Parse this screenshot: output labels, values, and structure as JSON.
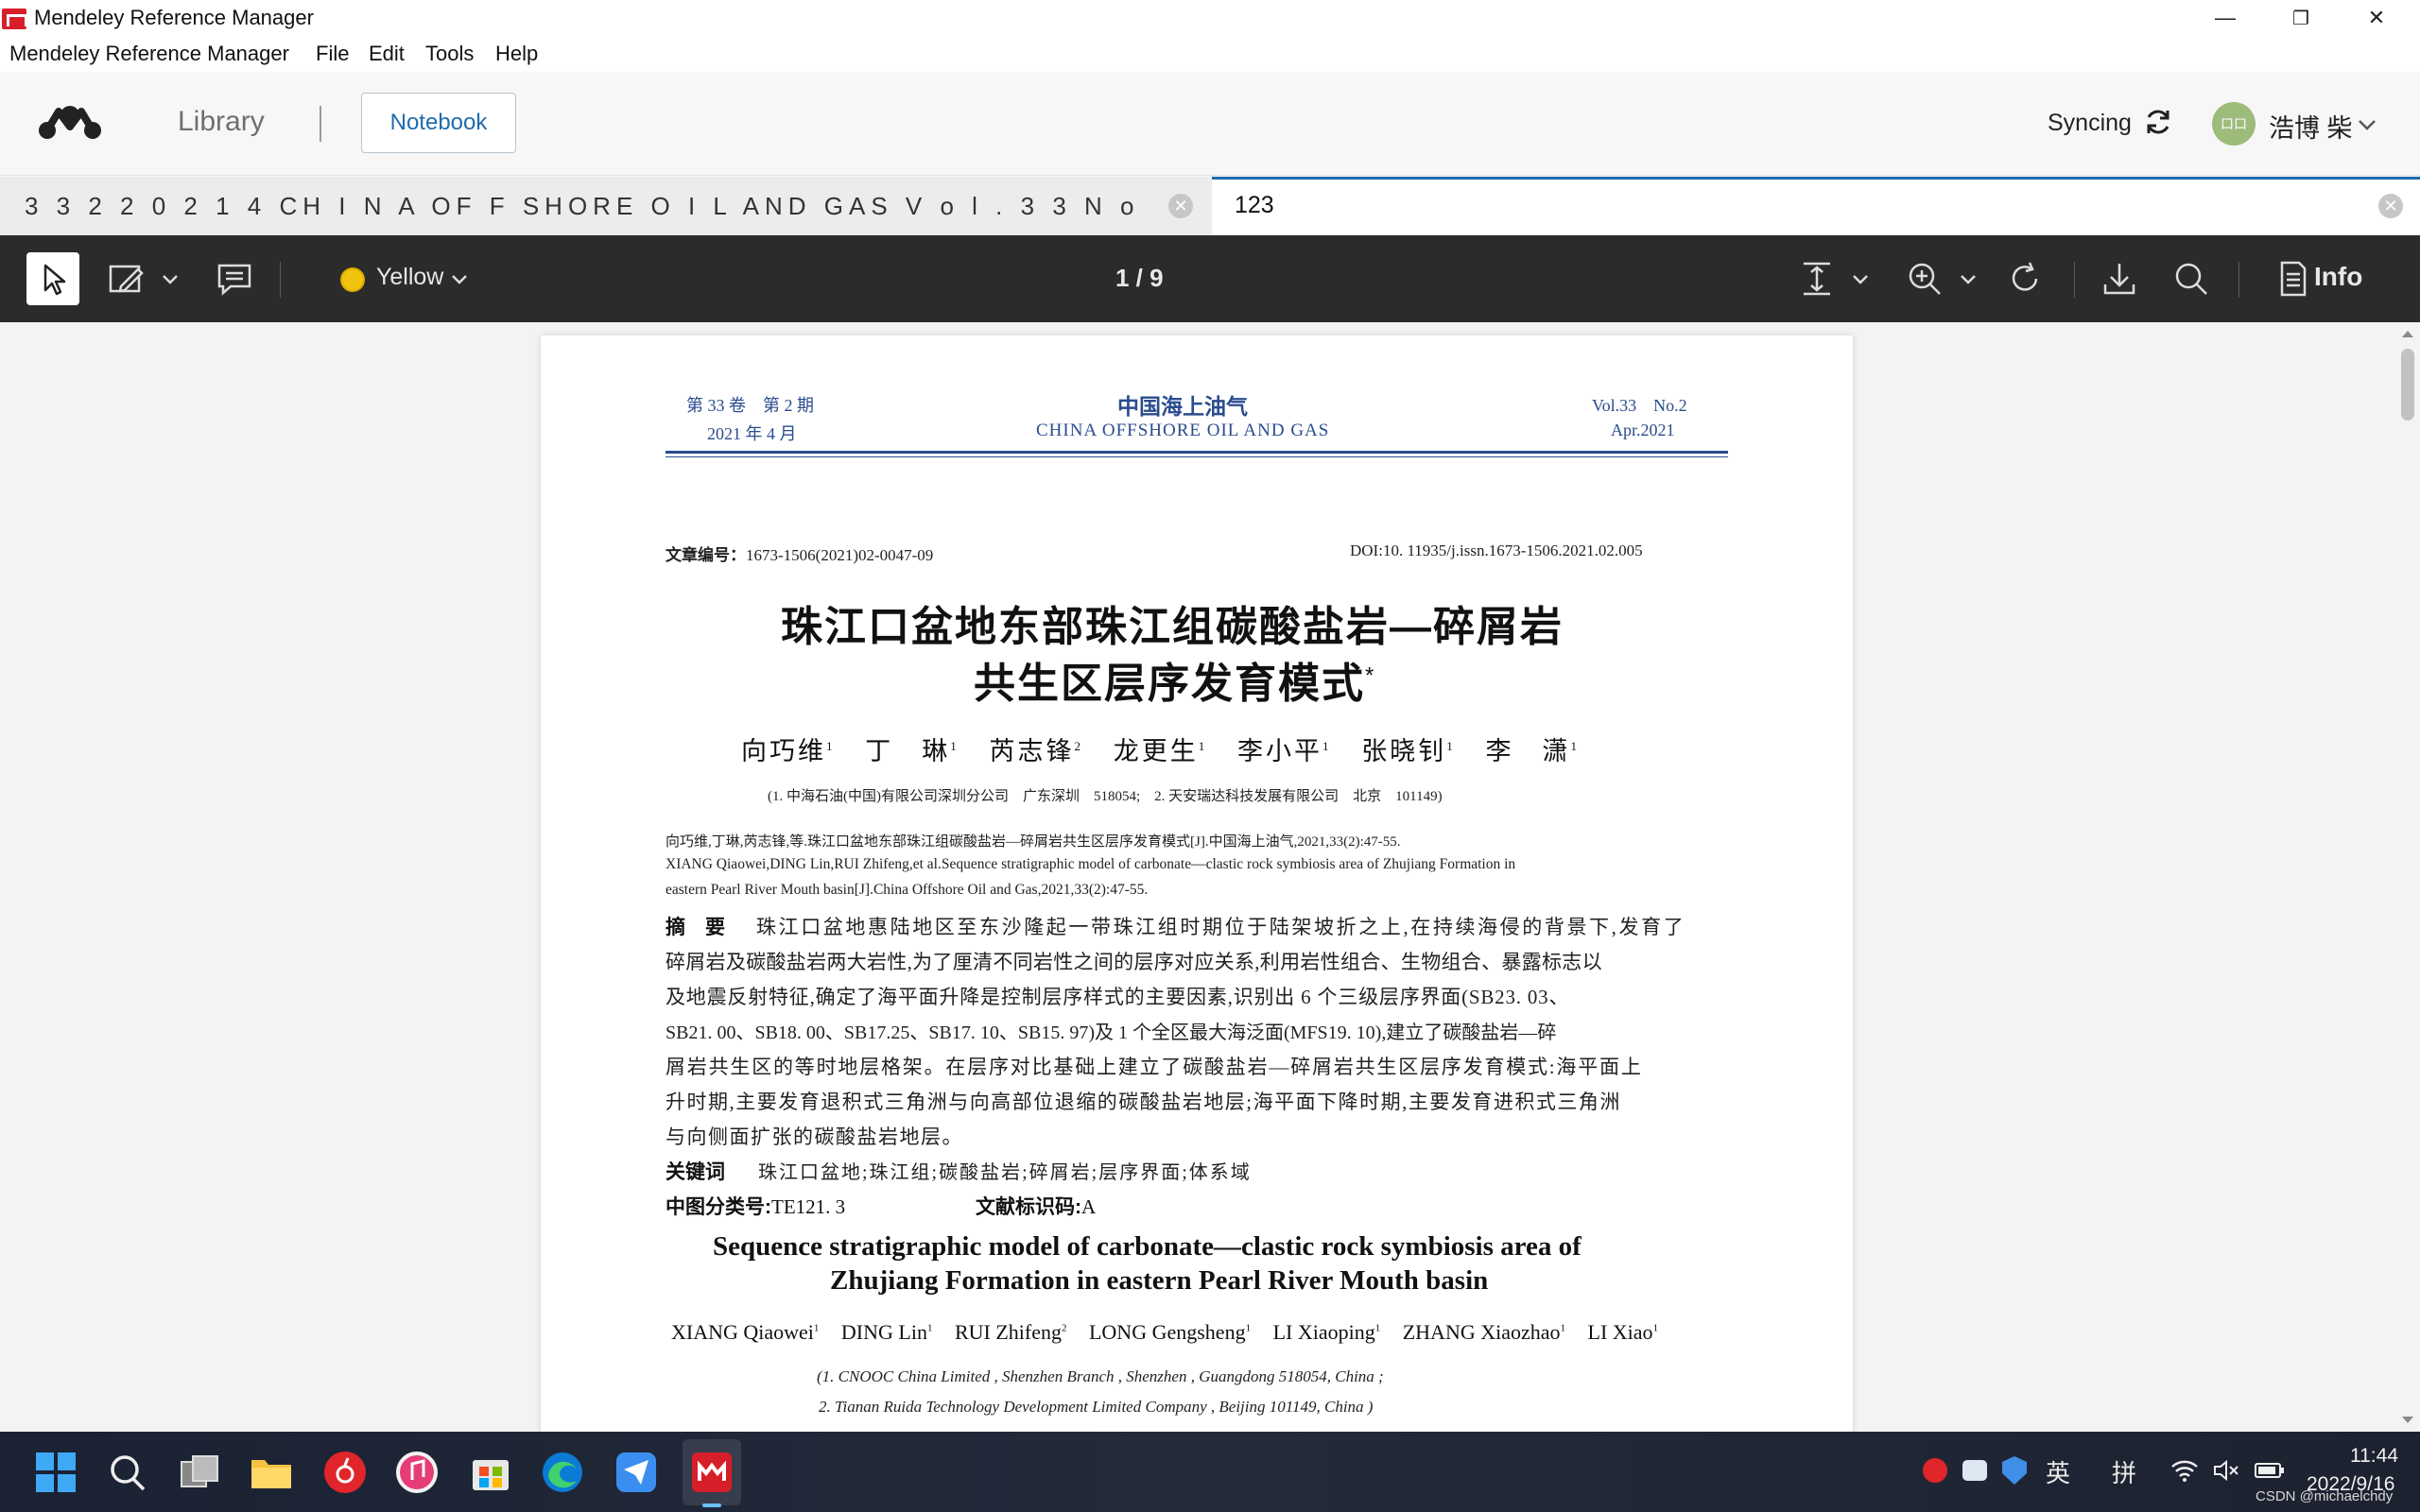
{
  "window": {
    "title": "Mendeley Reference Manager",
    "minimize": "—",
    "restore": "❐",
    "close": "✕"
  },
  "menu": [
    "Mendeley Reference Manager",
    "File",
    "Edit",
    "Tools",
    "Help"
  ],
  "header": {
    "library": "Library",
    "notebook": "Notebook",
    "sync_label": "Syncing",
    "user_name": "浩博 柴",
    "avatar_text": "口口"
  },
  "tabs": [
    {
      "label": "3 3 2 2 0 2 1 4 CH I N A OF F SHORE O I L AND GAS V o l . 3 3 N o . ...",
      "close": "✕"
    },
    {
      "label": "123",
      "close": "✕"
    }
  ],
  "toolbar": {
    "color_label": "Yellow",
    "page_indicator": "1 / 9",
    "info_label": "Info"
  },
  "document": {
    "header_left_1": "第 33 卷　第 2 期",
    "header_left_2": "2021 年 4 月",
    "header_center_1": "中国海上油气",
    "header_center_2": "CHINA OFFSHORE OIL AND GAS",
    "header_right_1": "Vol.33　No.2",
    "header_right_2": "Apr.2021",
    "article_no_label": "文章编号：",
    "article_no": "1673-1506(2021)02-0047-09",
    "doi": "DOI:10. 11935/j.issn.1673-1506.2021.02.005",
    "title_cn_1": "珠江口盆地东部珠江组碳酸盐岩—碎屑岩",
    "title_cn_2": "共生区层序发育模式",
    "title_cn_star": "*",
    "authors_cn": [
      "向巧维",
      "丁　琳",
      "芮志锋",
      "龙更生",
      "李小平",
      "张晓钊",
      "李　潇"
    ],
    "authors_cn_sup": [
      "1",
      "1",
      "2",
      "1",
      "1",
      "1",
      "1"
    ],
    "affil_cn": "(1. 中海石油(中国)有限公司深圳分公司　广东深圳　518054;　2. 天安瑞达科技发展有限公司　北京　101149)",
    "cite_1": "向巧维,丁琳,芮志锋,等.珠江口盆地东部珠江组碳酸盐岩—碎屑岩共生区层序发育模式[J].中国海上油气,2021,33(2):47-55.",
    "cite_2": "XIANG Qiaowei,DING Lin,RUI Zhifeng,et al.Sequence stratigraphic model of carbonate—clastic rock symbiosis area of Zhujiang Formation in",
    "cite_3": "eastern Pearl River Mouth basin[J].China Offshore Oil and Gas,2021,33(2):47-55.",
    "abstract_label": "摘　要",
    "abstract": [
      "珠江口盆地惠陆地区至东沙隆起一带珠江组时期位于陆架坡折之上,在持续海侵的背景下,发育了",
      "碎屑岩及碳酸盐岩两大岩性,为了厘清不同岩性之间的层序对应关系,利用岩性组合、生物组合、暴露标志以",
      "及地震反射特征,确定了海平面升降是控制层序样式的主要因素,识别出 6 个三级层序界面(SB23. 03、",
      "SB21. 00、SB18. 00、SB17.25、SB17. 10、SB15. 97)及 1 个全区最大海泛面(MFS19. 10),建立了碳酸盐岩—碎",
      "屑岩共生区的等时地层格架。在层序对比基础上建立了碳酸盐岩—碎屑岩共生区层序发育模式:海平面上",
      "升时期,主要发育退积式三角洲与向高部位退缩的碳酸盐岩地层;海平面下降时期,主要发育进积式三角洲",
      "与向侧面扩张的碳酸盐岩地层。"
    ],
    "keywords_label": "关键词",
    "keywords": "珠江口盆地;珠江组;碳酸盐岩;碎屑岩;层序界面;体系域",
    "clc_label": "中图分类号:",
    "clc": "TE121. 3",
    "doc_code_label": "文献标识码:",
    "doc_code": "A",
    "title_en_1": "Sequence stratigraphic model of carbonate—clastic rock symbiosis area of",
    "title_en_2": "Zhujiang Formation in eastern Pearl River Mouth basin",
    "authors_en": [
      "XIANG Qiaowei",
      "DING Lin",
      "RUI Zhifeng",
      "LONG Gengsheng",
      "LI Xiaoping",
      "ZHANG Xiaozhao",
      "LI Xiao"
    ],
    "authors_en_sup": [
      "1",
      "1",
      "2",
      "1",
      "1",
      "1",
      "1"
    ],
    "affil_en_1": "(1. CNOOC China Limited , Shenzhen Branch , Shenzhen , Guangdong 518054, China ;",
    "affil_en_2": "2. Tianan Ruida Technology Development Limited Company , Beijing 101149, China )"
  },
  "taskbar": {
    "tray_lang_1": "英",
    "tray_lang_2": "拼",
    "time": "11:44",
    "date": "2022/9/16",
    "watermark": "CSDN @michaelchdy"
  },
  "colors": {
    "accent": "#1f6bad",
    "toolbar_bg": "#2b2b2b",
    "highlight": "#f1c40f",
    "journal_blue": "#2a4c8e"
  }
}
